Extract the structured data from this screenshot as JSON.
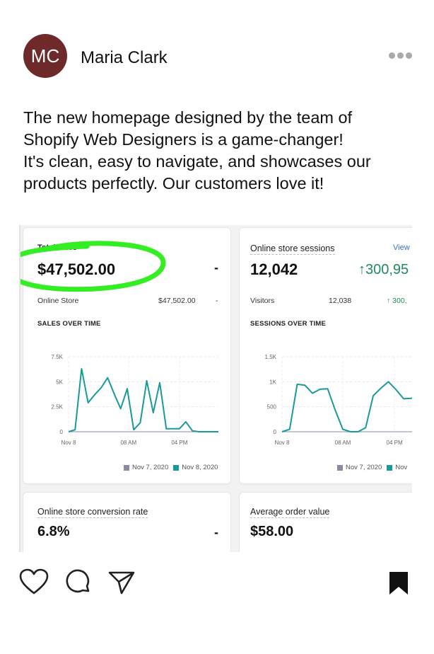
{
  "post": {
    "avatar_initials": "MC",
    "avatar_color": "#6e2a2a",
    "username": "Maria Clark",
    "caption_lines": [
      "The new homepage designed by the team of",
      "Shopify Web Designers is a game-changer!",
      "It's clean, easy to navigate, and showcases our",
      "products perfectly. Our customers love it!"
    ]
  },
  "dashboard": {
    "highlight_color": "#33ee22",
    "total_sales": {
      "title": "Total sales",
      "value": "$47,502.00",
      "dash": "-",
      "row_label": "Online Store",
      "row_value": "$47,502.00",
      "row_dash": "-",
      "section": "SALES OVER TIME",
      "legend": [
        "Nov 7, 2020",
        "Nov 8, 2020"
      ]
    },
    "sessions": {
      "title": "Online store sessions",
      "view": "View",
      "value": "12,042",
      "change": "↑300,95",
      "row_label": "Visitors",
      "row_value": "12,038",
      "row_change": "↑ 300,",
      "section": "SESSIONS OVER TIME",
      "legend": [
        "Nov 7, 2020",
        "Nov"
      ]
    },
    "conversion": {
      "title": "Online store conversion rate",
      "value": "6.8%",
      "dash": "-"
    },
    "aov": {
      "title": "Average order value",
      "value": "$58.00"
    }
  },
  "chart_data": [
    {
      "type": "line",
      "title": "SALES OVER TIME",
      "x_ticks": [
        "Nov 8",
        "08 AM",
        "04 PM"
      ],
      "y_ticks": [
        "0",
        "2.5K",
        "5K",
        "7.5K"
      ],
      "ylim": [
        0,
        7500
      ],
      "series": [
        {
          "name": "Nov 8, 2020",
          "color": "#199a9a",
          "values": [
            0,
            200,
            6300,
            2900,
            3700,
            4400,
            5400,
            3800,
            2300,
            4300,
            200,
            900,
            5100,
            1900,
            4900,
            300,
            300,
            300,
            1000,
            100,
            0,
            0,
            0,
            0
          ]
        },
        {
          "name": "Nov 7, 2020",
          "color": "#8a8aa0",
          "values": [
            0,
            0,
            0,
            0,
            0,
            0,
            0,
            0,
            0,
            0,
            0,
            0,
            0,
            0,
            0,
            0,
            0,
            0,
            0,
            0,
            0,
            0,
            0,
            0
          ]
        }
      ]
    },
    {
      "type": "line",
      "title": "SESSIONS OVER TIME",
      "x_ticks": [
        "Nov 8",
        "08 AM",
        "04 PM"
      ],
      "y_ticks": [
        "0",
        "500",
        "1K",
        "1.5K"
      ],
      "ylim": [
        0,
        1500
      ],
      "series": [
        {
          "name": "Nov",
          "color": "#199a9a",
          "values": [
            0,
            50,
            950,
            930,
            770,
            850,
            860,
            430,
            50,
            0,
            0,
            80,
            720,
            870,
            1000,
            840,
            660,
            670,
            700,
            680,
            600
          ]
        },
        {
          "name": "Nov 7, 2020",
          "color": "#8a8aa0",
          "values": [
            0,
            0,
            0,
            0,
            0,
            0,
            0,
            0,
            0,
            0,
            0,
            0,
            0,
            0,
            0,
            0,
            0,
            0,
            0,
            0,
            0
          ]
        }
      ]
    }
  ]
}
